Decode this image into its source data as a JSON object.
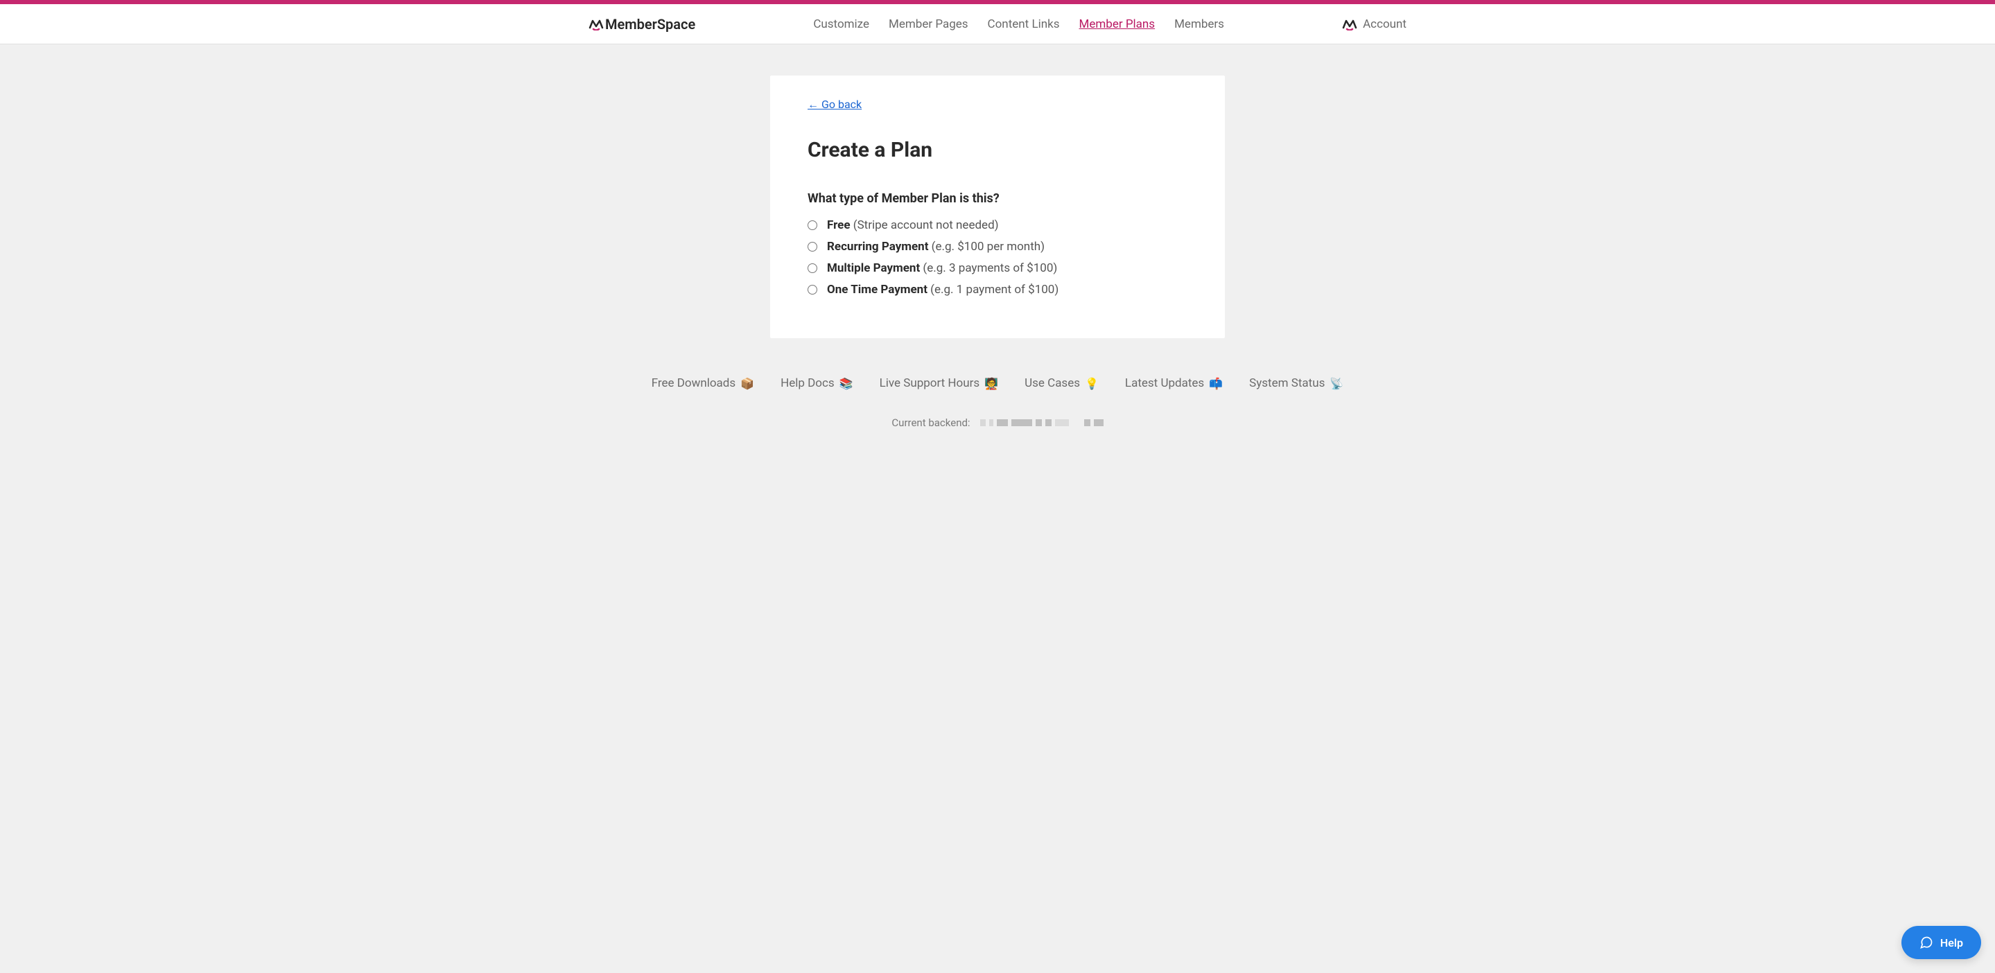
{
  "brand": "MemberSpace",
  "nav": {
    "customize": "Customize",
    "member_pages": "Member Pages",
    "content_links": "Content Links",
    "member_plans": "Member Plans",
    "members": "Members"
  },
  "account_label": "Account",
  "go_back": "← Go back",
  "page_title": "Create a Plan",
  "question": "What type of Member Plan is this?",
  "options": [
    {
      "name": "Free",
      "hint": " (Stripe account not needed)"
    },
    {
      "name": "Recurring Payment",
      "hint": " (e.g. $100 per month)"
    },
    {
      "name": "Multiple Payment",
      "hint": " (e.g. 3 payments of $100)"
    },
    {
      "name": "One Time Payment",
      "hint": " (e.g. 1 payment of $100)"
    }
  ],
  "footer": {
    "downloads": "Free Downloads",
    "downloads_emoji": "📦",
    "help_docs": "Help Docs",
    "help_docs_emoji": "📚",
    "support": "Live Support Hours",
    "support_emoji": "🧑‍🏫",
    "use_cases": "Use Cases",
    "use_cases_emoji": "💡",
    "updates": "Latest Updates",
    "updates_emoji": "📫",
    "status": "System Status",
    "status_emoji": "📡"
  },
  "backend_label": "Current backend:",
  "help_label": "Help"
}
